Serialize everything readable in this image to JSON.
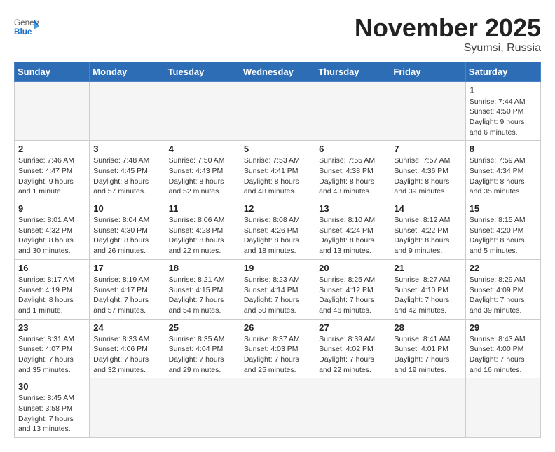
{
  "header": {
    "logo_general": "General",
    "logo_blue": "Blue",
    "month_title": "November 2025",
    "location": "Syumsi, Russia"
  },
  "weekdays": [
    "Sunday",
    "Monday",
    "Tuesday",
    "Wednesday",
    "Thursday",
    "Friday",
    "Saturday"
  ],
  "days": {
    "1": {
      "sunrise": "7:44 AM",
      "sunset": "4:50 PM",
      "daylight": "9 hours and 6 minutes."
    },
    "2": {
      "sunrise": "7:46 AM",
      "sunset": "4:47 PM",
      "daylight": "9 hours and 1 minute."
    },
    "3": {
      "sunrise": "7:48 AM",
      "sunset": "4:45 PM",
      "daylight": "8 hours and 57 minutes."
    },
    "4": {
      "sunrise": "7:50 AM",
      "sunset": "4:43 PM",
      "daylight": "8 hours and 52 minutes."
    },
    "5": {
      "sunrise": "7:53 AM",
      "sunset": "4:41 PM",
      "daylight": "8 hours and 48 minutes."
    },
    "6": {
      "sunrise": "7:55 AM",
      "sunset": "4:38 PM",
      "daylight": "8 hours and 43 minutes."
    },
    "7": {
      "sunrise": "7:57 AM",
      "sunset": "4:36 PM",
      "daylight": "8 hours and 39 minutes."
    },
    "8": {
      "sunrise": "7:59 AM",
      "sunset": "4:34 PM",
      "daylight": "8 hours and 35 minutes."
    },
    "9": {
      "sunrise": "8:01 AM",
      "sunset": "4:32 PM",
      "daylight": "8 hours and 30 minutes."
    },
    "10": {
      "sunrise": "8:04 AM",
      "sunset": "4:30 PM",
      "daylight": "8 hours and 26 minutes."
    },
    "11": {
      "sunrise": "8:06 AM",
      "sunset": "4:28 PM",
      "daylight": "8 hours and 22 minutes."
    },
    "12": {
      "sunrise": "8:08 AM",
      "sunset": "4:26 PM",
      "daylight": "8 hours and 18 minutes."
    },
    "13": {
      "sunrise": "8:10 AM",
      "sunset": "4:24 PM",
      "daylight": "8 hours and 13 minutes."
    },
    "14": {
      "sunrise": "8:12 AM",
      "sunset": "4:22 PM",
      "daylight": "8 hours and 9 minutes."
    },
    "15": {
      "sunrise": "8:15 AM",
      "sunset": "4:20 PM",
      "daylight": "8 hours and 5 minutes."
    },
    "16": {
      "sunrise": "8:17 AM",
      "sunset": "4:19 PM",
      "daylight": "8 hours and 1 minute."
    },
    "17": {
      "sunrise": "8:19 AM",
      "sunset": "4:17 PM",
      "daylight": "7 hours and 57 minutes."
    },
    "18": {
      "sunrise": "8:21 AM",
      "sunset": "4:15 PM",
      "daylight": "7 hours and 54 minutes."
    },
    "19": {
      "sunrise": "8:23 AM",
      "sunset": "4:14 PM",
      "daylight": "7 hours and 50 minutes."
    },
    "20": {
      "sunrise": "8:25 AM",
      "sunset": "4:12 PM",
      "daylight": "7 hours and 46 minutes."
    },
    "21": {
      "sunrise": "8:27 AM",
      "sunset": "4:10 PM",
      "daylight": "7 hours and 42 minutes."
    },
    "22": {
      "sunrise": "8:29 AM",
      "sunset": "4:09 PM",
      "daylight": "7 hours and 39 minutes."
    },
    "23": {
      "sunrise": "8:31 AM",
      "sunset": "4:07 PM",
      "daylight": "7 hours and 35 minutes."
    },
    "24": {
      "sunrise": "8:33 AM",
      "sunset": "4:06 PM",
      "daylight": "7 hours and 32 minutes."
    },
    "25": {
      "sunrise": "8:35 AM",
      "sunset": "4:04 PM",
      "daylight": "7 hours and 29 minutes."
    },
    "26": {
      "sunrise": "8:37 AM",
      "sunset": "4:03 PM",
      "daylight": "7 hours and 25 minutes."
    },
    "27": {
      "sunrise": "8:39 AM",
      "sunset": "4:02 PM",
      "daylight": "7 hours and 22 minutes."
    },
    "28": {
      "sunrise": "8:41 AM",
      "sunset": "4:01 PM",
      "daylight": "7 hours and 19 minutes."
    },
    "29": {
      "sunrise": "8:43 AM",
      "sunset": "4:00 PM",
      "daylight": "7 hours and 16 minutes."
    },
    "30": {
      "sunrise": "8:45 AM",
      "sunset": "3:58 PM",
      "daylight": "7 hours and 13 minutes."
    }
  }
}
